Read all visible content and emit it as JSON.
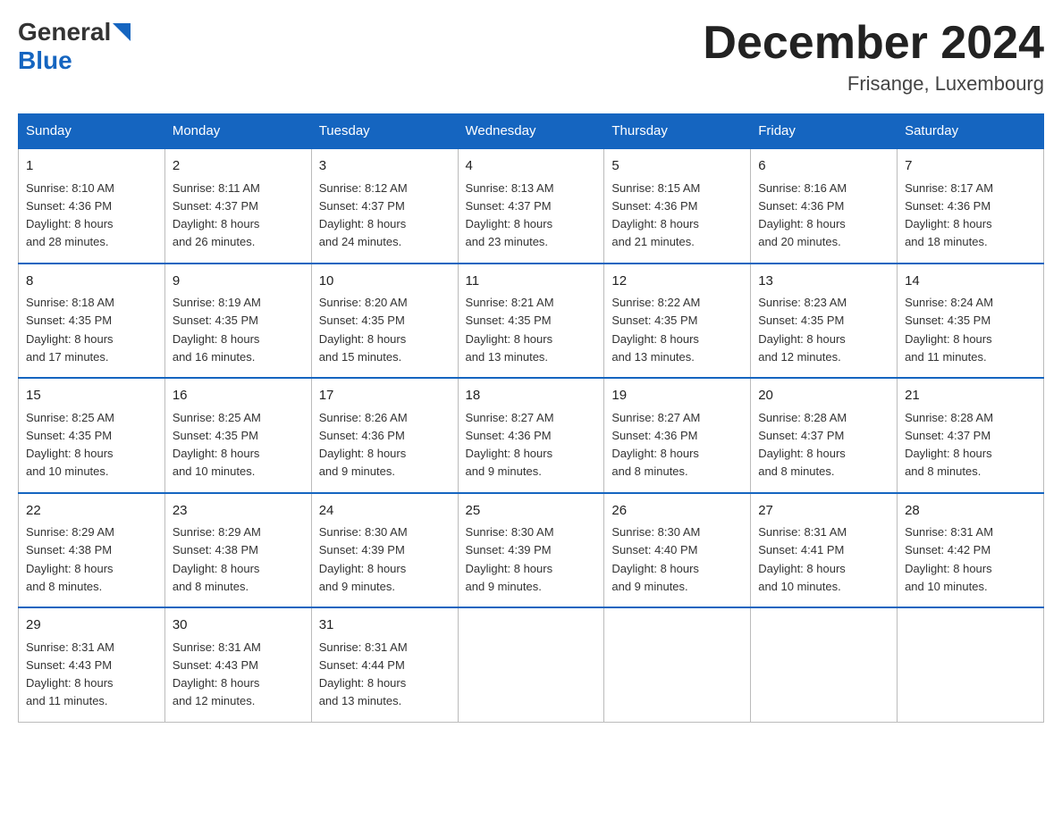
{
  "logo": {
    "general": "General",
    "blue": "Blue"
  },
  "header": {
    "month": "December 2024",
    "location": "Frisange, Luxembourg"
  },
  "weekdays": [
    "Sunday",
    "Monday",
    "Tuesday",
    "Wednesday",
    "Thursday",
    "Friday",
    "Saturday"
  ],
  "weeks": [
    [
      {
        "day": "1",
        "sunrise": "8:10 AM",
        "sunset": "4:36 PM",
        "daylight_h": "8 hours",
        "daylight_m": "and 28 minutes."
      },
      {
        "day": "2",
        "sunrise": "8:11 AM",
        "sunset": "4:37 PM",
        "daylight_h": "8 hours",
        "daylight_m": "and 26 minutes."
      },
      {
        "day": "3",
        "sunrise": "8:12 AM",
        "sunset": "4:37 PM",
        "daylight_h": "8 hours",
        "daylight_m": "and 24 minutes."
      },
      {
        "day": "4",
        "sunrise": "8:13 AM",
        "sunset": "4:37 PM",
        "daylight_h": "8 hours",
        "daylight_m": "and 23 minutes."
      },
      {
        "day": "5",
        "sunrise": "8:15 AM",
        "sunset": "4:36 PM",
        "daylight_h": "8 hours",
        "daylight_m": "and 21 minutes."
      },
      {
        "day": "6",
        "sunrise": "8:16 AM",
        "sunset": "4:36 PM",
        "daylight_h": "8 hours",
        "daylight_m": "and 20 minutes."
      },
      {
        "day": "7",
        "sunrise": "8:17 AM",
        "sunset": "4:36 PM",
        "daylight_h": "8 hours",
        "daylight_m": "and 18 minutes."
      }
    ],
    [
      {
        "day": "8",
        "sunrise": "8:18 AM",
        "sunset": "4:35 PM",
        "daylight_h": "8 hours",
        "daylight_m": "and 17 minutes."
      },
      {
        "day": "9",
        "sunrise": "8:19 AM",
        "sunset": "4:35 PM",
        "daylight_h": "8 hours",
        "daylight_m": "and 16 minutes."
      },
      {
        "day": "10",
        "sunrise": "8:20 AM",
        "sunset": "4:35 PM",
        "daylight_h": "8 hours",
        "daylight_m": "and 15 minutes."
      },
      {
        "day": "11",
        "sunrise": "8:21 AM",
        "sunset": "4:35 PM",
        "daylight_h": "8 hours",
        "daylight_m": "and 13 minutes."
      },
      {
        "day": "12",
        "sunrise": "8:22 AM",
        "sunset": "4:35 PM",
        "daylight_h": "8 hours",
        "daylight_m": "and 13 minutes."
      },
      {
        "day": "13",
        "sunrise": "8:23 AM",
        "sunset": "4:35 PM",
        "daylight_h": "8 hours",
        "daylight_m": "and 12 minutes."
      },
      {
        "day": "14",
        "sunrise": "8:24 AM",
        "sunset": "4:35 PM",
        "daylight_h": "8 hours",
        "daylight_m": "and 11 minutes."
      }
    ],
    [
      {
        "day": "15",
        "sunrise": "8:25 AM",
        "sunset": "4:35 PM",
        "daylight_h": "8 hours",
        "daylight_m": "and 10 minutes."
      },
      {
        "day": "16",
        "sunrise": "8:25 AM",
        "sunset": "4:35 PM",
        "daylight_h": "8 hours",
        "daylight_m": "and 10 minutes."
      },
      {
        "day": "17",
        "sunrise": "8:26 AM",
        "sunset": "4:36 PM",
        "daylight_h": "8 hours",
        "daylight_m": "and 9 minutes."
      },
      {
        "day": "18",
        "sunrise": "8:27 AM",
        "sunset": "4:36 PM",
        "daylight_h": "8 hours",
        "daylight_m": "and 9 minutes."
      },
      {
        "day": "19",
        "sunrise": "8:27 AM",
        "sunset": "4:36 PM",
        "daylight_h": "8 hours",
        "daylight_m": "and 8 minutes."
      },
      {
        "day": "20",
        "sunrise": "8:28 AM",
        "sunset": "4:37 PM",
        "daylight_h": "8 hours",
        "daylight_m": "and 8 minutes."
      },
      {
        "day": "21",
        "sunrise": "8:28 AM",
        "sunset": "4:37 PM",
        "daylight_h": "8 hours",
        "daylight_m": "and 8 minutes."
      }
    ],
    [
      {
        "day": "22",
        "sunrise": "8:29 AM",
        "sunset": "4:38 PM",
        "daylight_h": "8 hours",
        "daylight_m": "and 8 minutes."
      },
      {
        "day": "23",
        "sunrise": "8:29 AM",
        "sunset": "4:38 PM",
        "daylight_h": "8 hours",
        "daylight_m": "and 8 minutes."
      },
      {
        "day": "24",
        "sunrise": "8:30 AM",
        "sunset": "4:39 PM",
        "daylight_h": "8 hours",
        "daylight_m": "and 9 minutes."
      },
      {
        "day": "25",
        "sunrise": "8:30 AM",
        "sunset": "4:39 PM",
        "daylight_h": "8 hours",
        "daylight_m": "and 9 minutes."
      },
      {
        "day": "26",
        "sunrise": "8:30 AM",
        "sunset": "4:40 PM",
        "daylight_h": "8 hours",
        "daylight_m": "and 9 minutes."
      },
      {
        "day": "27",
        "sunrise": "8:31 AM",
        "sunset": "4:41 PM",
        "daylight_h": "8 hours",
        "daylight_m": "and 10 minutes."
      },
      {
        "day": "28",
        "sunrise": "8:31 AM",
        "sunset": "4:42 PM",
        "daylight_h": "8 hours",
        "daylight_m": "and 10 minutes."
      }
    ],
    [
      {
        "day": "29",
        "sunrise": "8:31 AM",
        "sunset": "4:43 PM",
        "daylight_h": "8 hours",
        "daylight_m": "and 11 minutes."
      },
      {
        "day": "30",
        "sunrise": "8:31 AM",
        "sunset": "4:43 PM",
        "daylight_h": "8 hours",
        "daylight_m": "and 12 minutes."
      },
      {
        "day": "31",
        "sunrise": "8:31 AM",
        "sunset": "4:44 PM",
        "daylight_h": "8 hours",
        "daylight_m": "and 13 minutes."
      },
      null,
      null,
      null,
      null
    ]
  ],
  "labels": {
    "sunrise": "Sunrise:",
    "sunset": "Sunset:",
    "daylight": "Daylight:"
  }
}
